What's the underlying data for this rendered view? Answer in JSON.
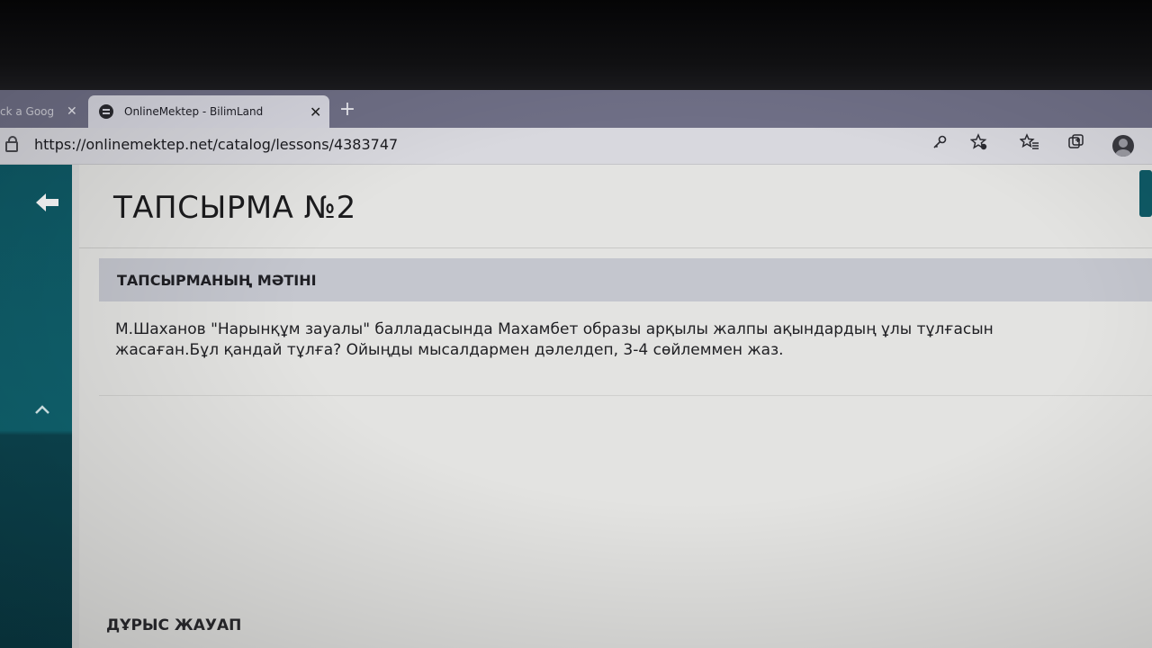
{
  "browser": {
    "tabs": [
      {
        "title": "ck a Goog",
        "active": false
      },
      {
        "title": "OnlineMektep - BilimLand",
        "active": true
      }
    ],
    "tab_close_glyph": "✕",
    "new_tab_glyph": "+",
    "url": "https://onlinemektep.net/catalog/lessons/4383747",
    "toolbar_icons": [
      "key-icon",
      "favorite-star-icon",
      "favorites-list-icon",
      "collections-icon",
      "profile-avatar-icon"
    ]
  },
  "sidebar": {
    "back_glyph": "🡐",
    "up_glyph": "⌃"
  },
  "page": {
    "title": "ТАПСЫРМА №2",
    "section_header": "ТАПСЫРМАНЫҢ МӘТІНІ",
    "task_text": "М.Шаханов \"Нарынқұм зауалы\" балладасында Махамбет образы арқылы жалпы ақындардың ұлы тұлғасын жасаған.Бұл қандай тұлға? Ойыңды мысалдармен дәлелдеп, 3-4 сөйлеммен жаз.",
    "answer_label": "ДҰРЫС ЖАУАП"
  },
  "colors": {
    "sidebar_teal": "#0f6470",
    "section_header_bg": "#c4c6ce"
  }
}
